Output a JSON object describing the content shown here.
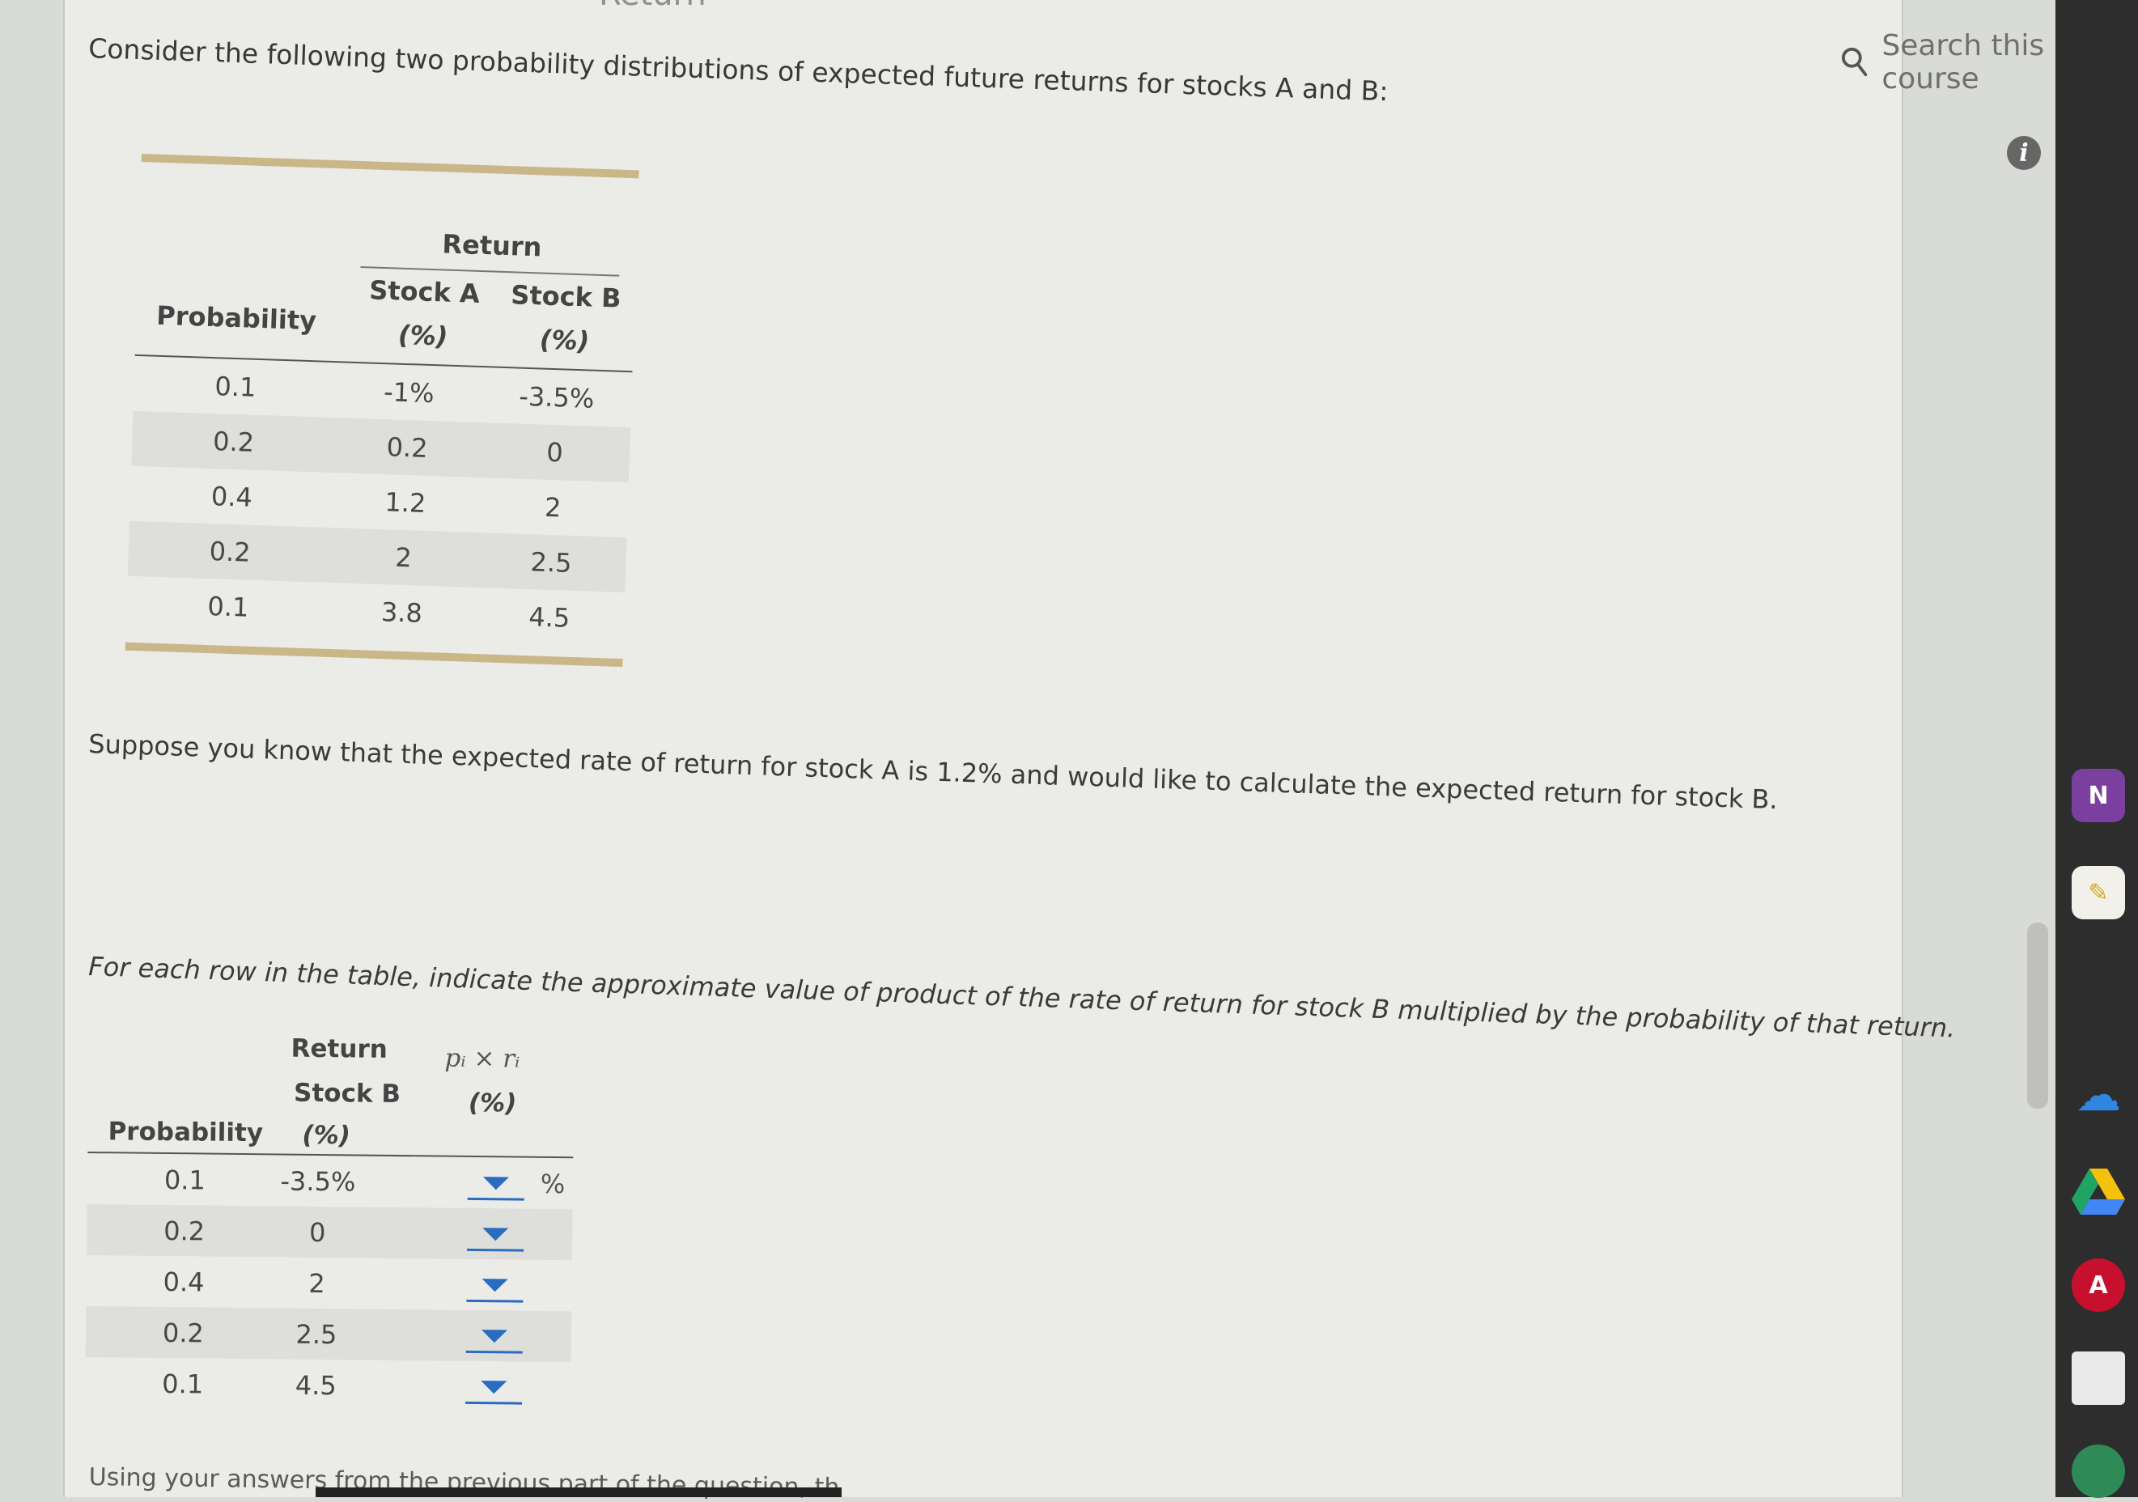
{
  "header": {
    "partial_title": "Return",
    "search_placeholder": "Search this course"
  },
  "question": {
    "intro": "Consider the following two probability distributions of expected future returns for stocks A and B:",
    "middle": "Suppose you know that the expected rate of return for stock A is 1.2% and would like to calculate the expected return for stock B.",
    "instruction": "For each row in the table, indicate the approximate value of product of the rate of return for stock B multiplied by the probability of that return.",
    "next_partial": "Using your answers from the previous part of the question, th"
  },
  "table1": {
    "group_header": "Return",
    "col_probability": "Probability",
    "col_stock_a": "Stock A",
    "col_stock_b": "Stock B",
    "unit": "(%)",
    "rows": [
      {
        "p": "0.1",
        "a": "-1%",
        "b": "-3.5%"
      },
      {
        "p": "0.2",
        "a": "0.2",
        "b": "0"
      },
      {
        "p": "0.4",
        "a": "1.2",
        "b": "2"
      },
      {
        "p": "0.2",
        "a": "2",
        "b": "2.5"
      },
      {
        "p": "0.1",
        "a": "3.8",
        "b": "4.5"
      }
    ]
  },
  "table2": {
    "col_return": "Return",
    "col_stock_b": "Stock B",
    "unit": "(%)",
    "col_probability": "Probability",
    "col_product": "pᵢ × rᵢ",
    "col_product_unit": "(%)",
    "percent_suffix": "%",
    "rows": [
      {
        "p": "0.1",
        "b": "-3.5%"
      },
      {
        "p": "0.2",
        "b": "0"
      },
      {
        "p": "0.4",
        "b": "2"
      },
      {
        "p": "0.2",
        "b": "2.5"
      },
      {
        "p": "0.1",
        "b": "4.5"
      }
    ]
  },
  "colors": {
    "accent_blue": "#2a6cbf",
    "gold_rule": "#c9b788",
    "row_shade": "#dedfdb"
  },
  "dock_icons": [
    "onenote-icon",
    "sticky-notes-icon",
    "onedrive-icon",
    "google-drive-icon",
    "acrobat-icon"
  ]
}
